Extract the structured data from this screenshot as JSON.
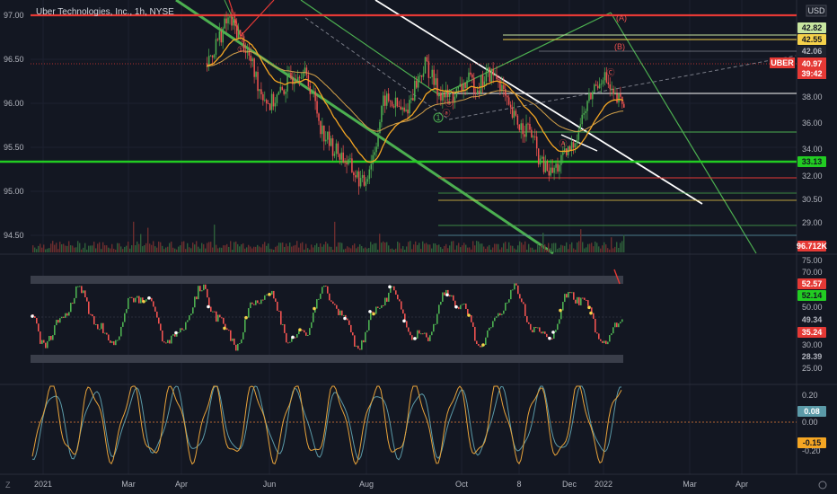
{
  "header": {
    "title": "Uber Technologies, Inc., 1h, NYSE",
    "currency": "USD"
  },
  "chart_data": {
    "type": "line",
    "panes": [
      {
        "name": "price",
        "symbol": "UBER",
        "symbol_price": "40.97",
        "symbol_countdown": "39:42",
        "left_axis": {
          "ticks": [
            "97.00",
            "96.50",
            "96.00",
            "95.50",
            "95.00",
            "94.50"
          ]
        },
        "right_axis": {
          "ticks": [
            "38.00",
            "36.00",
            "34.00",
            "32.00",
            "30.50",
            "29.00"
          ]
        },
        "tags": [
          {
            "text": "42.82",
            "bg": "#c8e6a0",
            "fg": "#131722"
          },
          {
            "text": "42.55",
            "bg": "#f5d14a",
            "fg": "#131722"
          },
          {
            "text": "42.06",
            "bg": "#1e222d",
            "fg": "#b2b5be"
          },
          {
            "text": "33.13",
            "bg": "#22cc22",
            "fg": "#131722"
          },
          {
            "text": "96.712K",
            "bg": "#e53935",
            "fg": "#ffffff"
          }
        ],
        "price_series": [
          44.5,
          46.5,
          48.3,
          47.2,
          45.1,
          42.4,
          40.9,
          41.8,
          43.2,
          44.1,
          42.3,
          38.7,
          37.2,
          36.4,
          35.1,
          33.9,
          36.8,
          41.4,
          40.9,
          40.1,
          42.7,
          44.5,
          42.3,
          41.5,
          41.9,
          43.0,
          42.5,
          43.6,
          43.2,
          40.2,
          39.1,
          38.7,
          35.8,
          34.9,
          36.0,
          37.2,
          39.8,
          42.1,
          43.6,
          41.4,
          40.97
        ],
        "wave_labels_green": [
          "1"
        ],
        "wave_labels_red": [
          "①",
          "ⓑ",
          "ⓐ",
          "Ⓐ",
          "Ⓒ",
          "(B)",
          "(A)"
        ]
      },
      {
        "name": "oscillator",
        "right_axis": {
          "ticks": [
            "75.00",
            "70.00",
            "50.00",
            "30.00",
            "25.00"
          ]
        },
        "tags": [
          {
            "text": "52.57",
            "bg": "#e53935",
            "fg": "#ffffff"
          },
          {
            "text": "52.14",
            "bg": "#22cc22",
            "fg": "#131722"
          },
          {
            "text": "49.34",
            "bg": "#131722",
            "fg": "#b2b5be"
          },
          {
            "text": "35.24",
            "bg": "#e53935",
            "fg": "#ffffff"
          },
          {
            "text": "28.39",
            "bg": "#131722",
            "fg": "#b2b5be"
          }
        ]
      },
      {
        "name": "stochastic",
        "right_axis": {
          "ticks": [
            "0.20",
            "0.00",
            "-0.20"
          ]
        },
        "tags": [
          {
            "text": "0.08",
            "bg": "#5b9aa8",
            "fg": "#ffffff"
          },
          {
            "text": "-0.15",
            "bg": "#f5a623",
            "fg": "#131722"
          }
        ]
      }
    ],
    "x_axis": {
      "ticks": [
        "2021",
        "Mar",
        "Apr",
        "Jun",
        "Aug",
        "Oct",
        "8",
        "Dec",
        "2022",
        "Mar",
        "Apr"
      ]
    },
    "colors": {
      "up": "#4caf50",
      "down": "#ef5350",
      "ema": "#f5a623",
      "trend_green": "#4caf50",
      "trend_white": "#ffffff",
      "resistance": "#e53935"
    }
  }
}
